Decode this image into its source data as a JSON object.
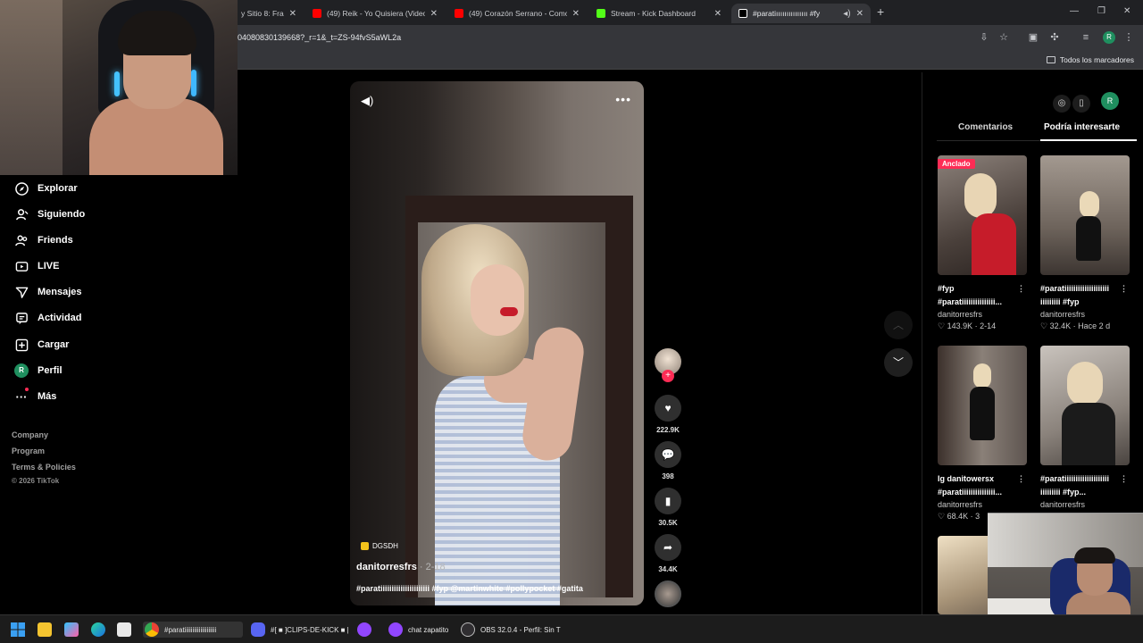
{
  "browser": {
    "tabs": [
      {
        "title": "y Sitio 8: Franc",
        "color": "#888888"
      },
      {
        "title": "(49) Reik - Yo Quisiera (Video)",
        "color": "#ff0000"
      },
      {
        "title": "(49) Corazón Serrano - Como S",
        "color": "#ff0000"
      },
      {
        "title": "Stream - Kick Dashboard",
        "color": "#53fc18"
      },
      {
        "title": "#paratiııııııııııııııı #fy",
        "color": "#ffffff"
      }
    ],
    "url": "04080830139668?_r=1&_t=ZS-94fvS5aWL2a",
    "bookmarks_label": "Todos los marcadores",
    "profile_initial": "R"
  },
  "sidebar": {
    "items": [
      {
        "label": "Explorar",
        "icon": "compass-icon"
      },
      {
        "label": "Siguiendo",
        "icon": "user-follow-icon"
      },
      {
        "label": "Friends",
        "icon": "friends-icon"
      },
      {
        "label": "LIVE",
        "icon": "live-icon"
      },
      {
        "label": "Mensajes",
        "icon": "send-icon"
      },
      {
        "label": "Actividad",
        "icon": "activity-icon"
      },
      {
        "label": "Cargar",
        "icon": "upload-icon"
      },
      {
        "label": "Perfil",
        "icon": "avatar-icon"
      },
      {
        "label": "Más",
        "icon": "more-icon"
      }
    ],
    "perfil_initial": "R",
    "footer": [
      "Company",
      "Program",
      "Terms & Policies"
    ],
    "copyright": "© 2026 TikTok"
  },
  "video": {
    "badge": "DGSDH",
    "author": "danitorresfrs",
    "date": " · 2-18",
    "caption": "#paratiiiiiiiiiiiiiiiiiiiiii #fyp @martinwhite #pollypocket #gatita",
    "actions": {
      "likes": "222.9K",
      "comments": "398",
      "saves": "30.5K",
      "shares": "34.4K"
    }
  },
  "panel": {
    "tabs": [
      "Comentarios",
      "Podría interesarte"
    ],
    "pinned_label": "Anclado",
    "cards": [
      {
        "title": "#fyp #paratiiiiiiiiiiiiiii...",
        "author": "danitorresfrs",
        "stats": "♡ 143.9K · 2-14",
        "colors": [
          "#6b5e55",
          "#c61c2a"
        ]
      },
      {
        "title": "#paratiiiiiiiiiiiiiiiiiiii iiiiiiiii #fyp",
        "author": "danitorresfrs",
        "stats": "♡ 32.4K · Hace 2 d",
        "colors": [
          "#8a7f74",
          "#141414"
        ]
      },
      {
        "title": "Ig danitowersx #paratiiiiiiiiiiiiiii...",
        "author": "danitorresfrs",
        "stats": "♡ 68.4K · 3",
        "colors": [
          "#7d7570",
          "#101010"
        ]
      },
      {
        "title": "#paratiiiiiiiiiiiiiiiiiiii iiiiiiiii #fyp...",
        "author": "danitorresfrs",
        "stats": "",
        "colors": [
          "#9d958e",
          "#1b1b1b"
        ]
      }
    ]
  },
  "taskbar": {
    "items": [
      {
        "label": "#paratiiiiiiiiiiiiiiiiiiii",
        "color": "#4285f4"
      },
      {
        "label": "#[ ■ ]CLIPS-DE-KICK ■ |",
        "color": "#5865f2"
      },
      {
        "label": "chat zapatito",
        "color": "#9146ff"
      },
      {
        "label": "OBS 32.0.4 - Perfil: Sin T",
        "color": "#302e31"
      }
    ]
  }
}
